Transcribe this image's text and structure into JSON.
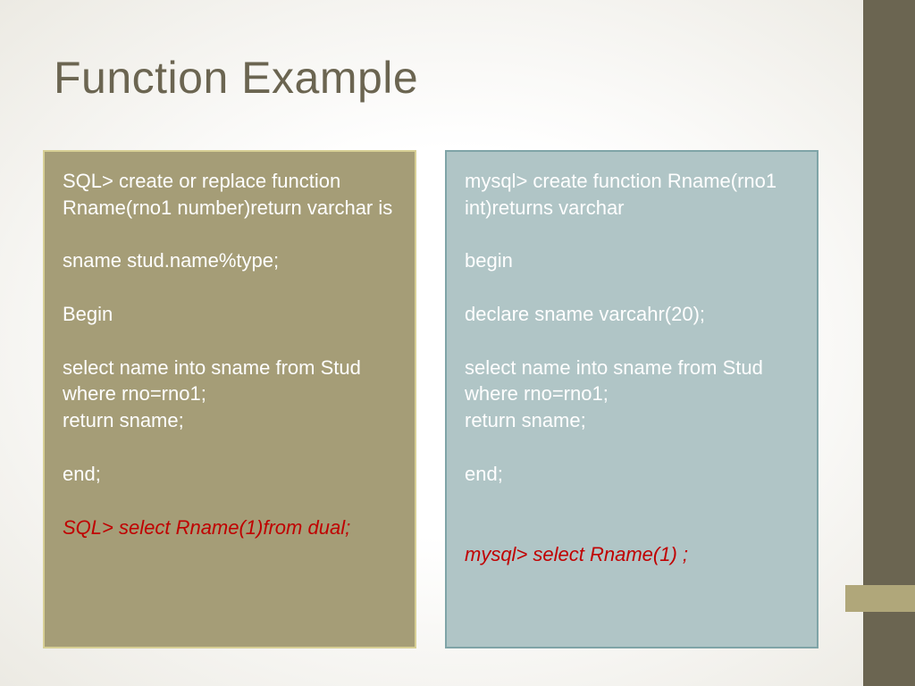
{
  "title": "Function Example",
  "left": {
    "l1": "SQL> create or replace function Rname(rno1  number)return varchar is",
    "l2": "sname stud.name%type;",
    "l3": "Begin",
    "l4": "select name into sname from Stud  where rno=rno1;",
    "l5": "return sname;",
    "l6": "end;",
    "l7": "SQL> select Rname(1)from dual;"
  },
  "right": {
    "r1": "mysql> create function Rname(rno1 int)returns varchar",
    "r2": "begin",
    "r3": "declare sname varcahr(20);",
    "r4": "select name into sname from Stud  where rno=rno1;",
    "r5": "return sname;",
    "r6": "end;",
    "r7": "mysql> select Rname(1) ;"
  }
}
